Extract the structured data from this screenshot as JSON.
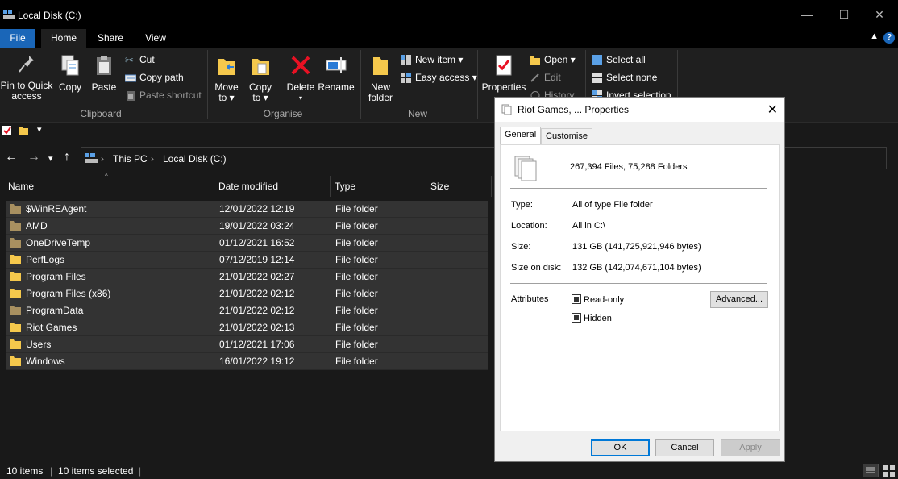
{
  "window": {
    "title": "Local Disk (C:)",
    "minimize": "—",
    "maximize": "☐",
    "close": "✕"
  },
  "ribbon_tabs": {
    "file": "File",
    "home": "Home",
    "share": "Share",
    "view": "View"
  },
  "ribbon": {
    "clipboard": {
      "label": "Clipboard",
      "pin": "Pin to Quick access",
      "copy": "Copy",
      "paste": "Paste",
      "cut": "Cut",
      "copy_path": "Copy path",
      "paste_shortcut": "Paste shortcut"
    },
    "organise": {
      "label": "Organise",
      "move_to": "Move to",
      "copy_to": "Copy to",
      "delete": "Delete",
      "rename": "Rename"
    },
    "new": {
      "label": "New",
      "new_folder": "New folder",
      "new_item": "New item",
      "easy_access": "Easy access"
    },
    "open": {
      "properties": "Properties",
      "open": "Open",
      "edit": "Edit",
      "history": "History"
    },
    "select": {
      "select_all": "Select all",
      "select_none": "Select none",
      "invert_selection": "Invert selection"
    }
  },
  "address": {
    "crumbs": [
      "This PC",
      "Local Disk (C:)"
    ]
  },
  "columns": {
    "name": "Name",
    "date_modified": "Date modified",
    "type": "Type",
    "size": "Size"
  },
  "files": [
    {
      "name": "$WinREAgent",
      "date": "12/01/2022 12:19",
      "type": "File folder",
      "hidden": true
    },
    {
      "name": "AMD",
      "date": "19/01/2022 03:24",
      "type": "File folder",
      "hidden": true
    },
    {
      "name": "OneDriveTemp",
      "date": "01/12/2021 16:52",
      "type": "File folder",
      "hidden": true
    },
    {
      "name": "PerfLogs",
      "date": "07/12/2019 12:14",
      "type": "File folder",
      "hidden": false
    },
    {
      "name": "Program Files",
      "date": "21/01/2022 02:27",
      "type": "File folder",
      "hidden": false
    },
    {
      "name": "Program Files (x86)",
      "date": "21/01/2022 02:12",
      "type": "File folder",
      "hidden": false
    },
    {
      "name": "ProgramData",
      "date": "21/01/2022 02:12",
      "type": "File folder",
      "hidden": true
    },
    {
      "name": "Riot Games",
      "date": "21/01/2022 02:13",
      "type": "File folder",
      "hidden": false
    },
    {
      "name": "Users",
      "date": "01/12/2021 17:06",
      "type": "File folder",
      "hidden": false
    },
    {
      "name": "Windows",
      "date": "16/01/2022 19:12",
      "type": "File folder",
      "hidden": false
    }
  ],
  "status": {
    "items": "10 items",
    "selected": "10 items selected"
  },
  "dialog": {
    "title": "Riot Games, ... Properties",
    "tabs": {
      "general": "General",
      "customise": "Customise"
    },
    "summary": "267,394 Files, 75,288 Folders",
    "fields": [
      {
        "label": "Type:",
        "value": "All of type File folder"
      },
      {
        "label": "Location:",
        "value": "All in C:\\"
      },
      {
        "label": "Size:",
        "value": "131 GB (141,725,921,946 bytes)"
      },
      {
        "label": "Size on disk:",
        "value": "132 GB (142,074,671,104 bytes)"
      }
    ],
    "attributes_label": "Attributes",
    "read_only": "Read-only",
    "hidden": "Hidden",
    "advanced": "Advanced...",
    "ok": "OK",
    "cancel": "Cancel",
    "apply": "Apply"
  },
  "colors": {
    "accent": "#1a66b8",
    "folder": "#f5c84c",
    "folder_hidden": "#a89060",
    "delete_red": "#e81123",
    "background": "#191919"
  }
}
